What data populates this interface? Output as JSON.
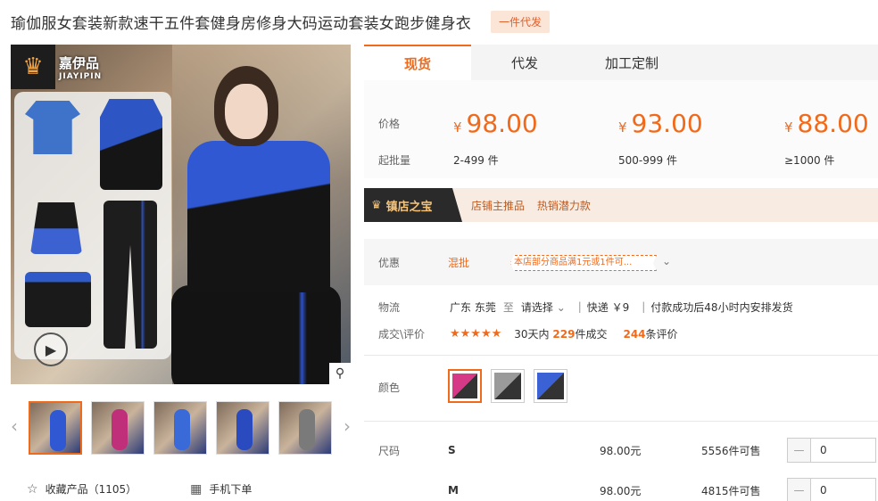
{
  "product": {
    "title": "瑜伽服女套装新款速干五件套健身房修身大码运动套装女跑步健身衣",
    "badge": "一件代发"
  },
  "gallery": {
    "logo_cn": "嘉伊品",
    "logo_en": "JIAYIPIN",
    "play_icon": "play-icon",
    "zoom_icon": "magnifier-icon",
    "thumbnail_count": 5,
    "active_thumbnail": 1
  },
  "actions": {
    "favorite_label": "收藏产品（1105）",
    "mobile_label": "手机下单"
  },
  "tabs": [
    {
      "label": "现货",
      "active": true
    },
    {
      "label": "代发",
      "active": false
    },
    {
      "label": "加工定制",
      "active": false
    }
  ],
  "pricing": {
    "price_label": "价格",
    "moq_label": "起批量",
    "tiers": [
      {
        "currency": "¥",
        "price": "98.00",
        "qty": "2-499 件"
      },
      {
        "currency": "¥",
        "price": "93.00",
        "qty": "500-999 件"
      },
      {
        "currency": "¥",
        "price": "88.00",
        "qty": "≥1000 件"
      }
    ]
  },
  "treasure": {
    "tag": "镇店之宝",
    "text1": "店铺主推品",
    "text2": "热销潜力款"
  },
  "promo": {
    "label": "优惠",
    "mix": "混批",
    "coupon": "本店部分商品满1元或1件可...",
    "expand_icon": "chevron-down-icon"
  },
  "logistics": {
    "label": "物流",
    "origin": "广东 东莞",
    "to": "至",
    "destination": "请选择",
    "express": "快递 ￥9",
    "dispatch": "付款成功后48小时内安排发货"
  },
  "reviews": {
    "label": "成交\\评价",
    "stars": "★★★★★",
    "deals_prefix": "30天内",
    "deals_count": "229",
    "deals_suffix": "件成交",
    "review_count": "244",
    "review_suffix": "条评价"
  },
  "colors": {
    "label": "颜色",
    "options": [
      "pink",
      "grey",
      "blue"
    ],
    "selected": 0
  },
  "sizes": {
    "label": "尺码",
    "rows": [
      {
        "name": "S",
        "price": "98.00元",
        "stock": "5556件可售",
        "qty": "0"
      },
      {
        "name": "M",
        "price": "98.00元",
        "stock": "4815件可售",
        "qty": "0"
      }
    ]
  },
  "theme": {
    "accent": "#f06a1c",
    "blue": "#2f58d2"
  }
}
